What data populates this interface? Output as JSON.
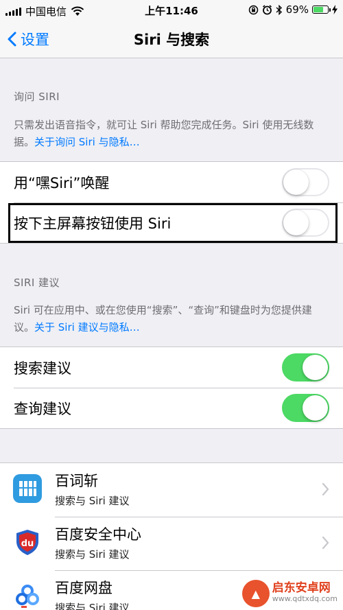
{
  "status_bar": {
    "carrier": "中国电信",
    "time": "上午11:46",
    "battery_percent": "69%",
    "battery_level": 0.69,
    "battery_color": "#4cd964"
  },
  "nav": {
    "back_label": "设置",
    "title": "Siri 与搜索"
  },
  "ask_siri": {
    "header": "询问 SIRI",
    "footer": "只需发出语音指令，就可让 Siri 帮助您完成任务。Siri 使用无线数据。",
    "footer_link": "关于询问 Siri 与隐私…",
    "rows": [
      {
        "label": "用“嘿Siri”唤醒",
        "on": false
      },
      {
        "label": "按下主屏幕按钮使用 Siri",
        "on": false
      }
    ]
  },
  "siri_suggestions": {
    "header": "SIRI 建议",
    "footer": "Siri 可在应用中、或在您使用“搜索”、“查询”和键盘时为您提供建议。",
    "footer_link": "关于 Siri 建议与隐私…",
    "rows": [
      {
        "label": "搜索建议",
        "on": true
      },
      {
        "label": "查询建议",
        "on": true
      }
    ]
  },
  "apps": [
    {
      "name": "百词斩",
      "subtitle": "搜索与 Siri 建议",
      "icon": "baicizhan-icon"
    },
    {
      "name": "百度安全中心",
      "subtitle": "搜索与 Siri 建议",
      "icon": "baidu-security-icon"
    },
    {
      "name": "百度网盘",
      "subtitle": "搜索与 Siri 建议",
      "icon": "baidu-netdisk-icon"
    }
  ],
  "watermark": {
    "title": "启东安卓网",
    "url": "www.qdtxdq.com"
  },
  "colors": {
    "accent": "#007aff",
    "toggle_on": "#4cd964",
    "background": "#efeff4"
  }
}
